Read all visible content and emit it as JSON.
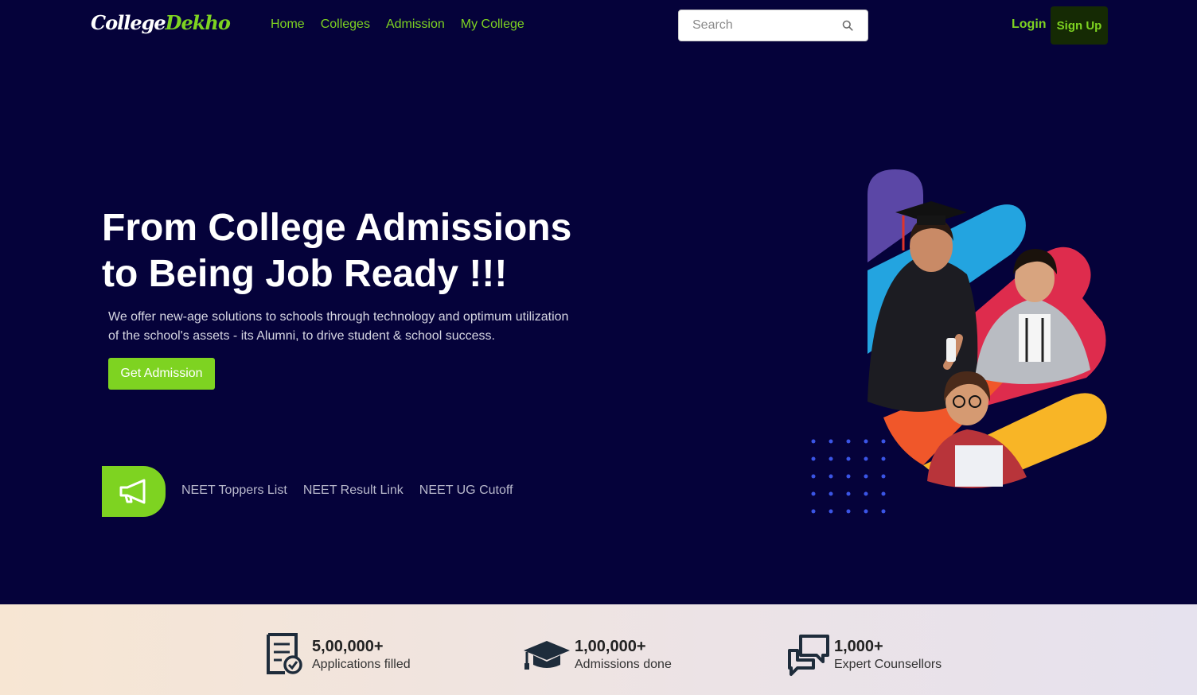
{
  "header": {
    "logo": {
      "part1": "College",
      "part2": "Dekho"
    },
    "nav": [
      "Home",
      "Colleges",
      "Admission",
      "My College"
    ],
    "search_placeholder": "Search",
    "login": "Login",
    "signup": "Sign Up"
  },
  "hero": {
    "title_line1": "From College Admissions",
    "title_line2": "to Being Job Ready !!!",
    "description": "We offer new-age solutions to schools through technology and optimum utilization of the school's assets - its Alumni, to drive student & school success.",
    "cta": "Get Admission"
  },
  "quick_links": [
    "NEET Toppers List",
    "NEET Result Link",
    "NEET UG Cutoff"
  ],
  "stats": [
    {
      "value": "5,00,000+",
      "label": "Applications filled",
      "icon": "application-form-icon"
    },
    {
      "value": "1,00,000+",
      "label": "Admissions done",
      "icon": "graduation-cap-icon"
    },
    {
      "value": "1,000+",
      "label": "Expert Counsellors",
      "icon": "chat-bubbles-icon"
    }
  ],
  "colors": {
    "background": "#05023a",
    "accent": "#7ed321",
    "signup_bg": "#152a04",
    "stripe_purple": "#5b47a6",
    "stripe_blue": "#23a4e0",
    "stripe_red": "#de2c4d",
    "stripe_orange": "#f0572a",
    "stripe_yellow": "#f8b526",
    "dots": "#3b55e6"
  }
}
